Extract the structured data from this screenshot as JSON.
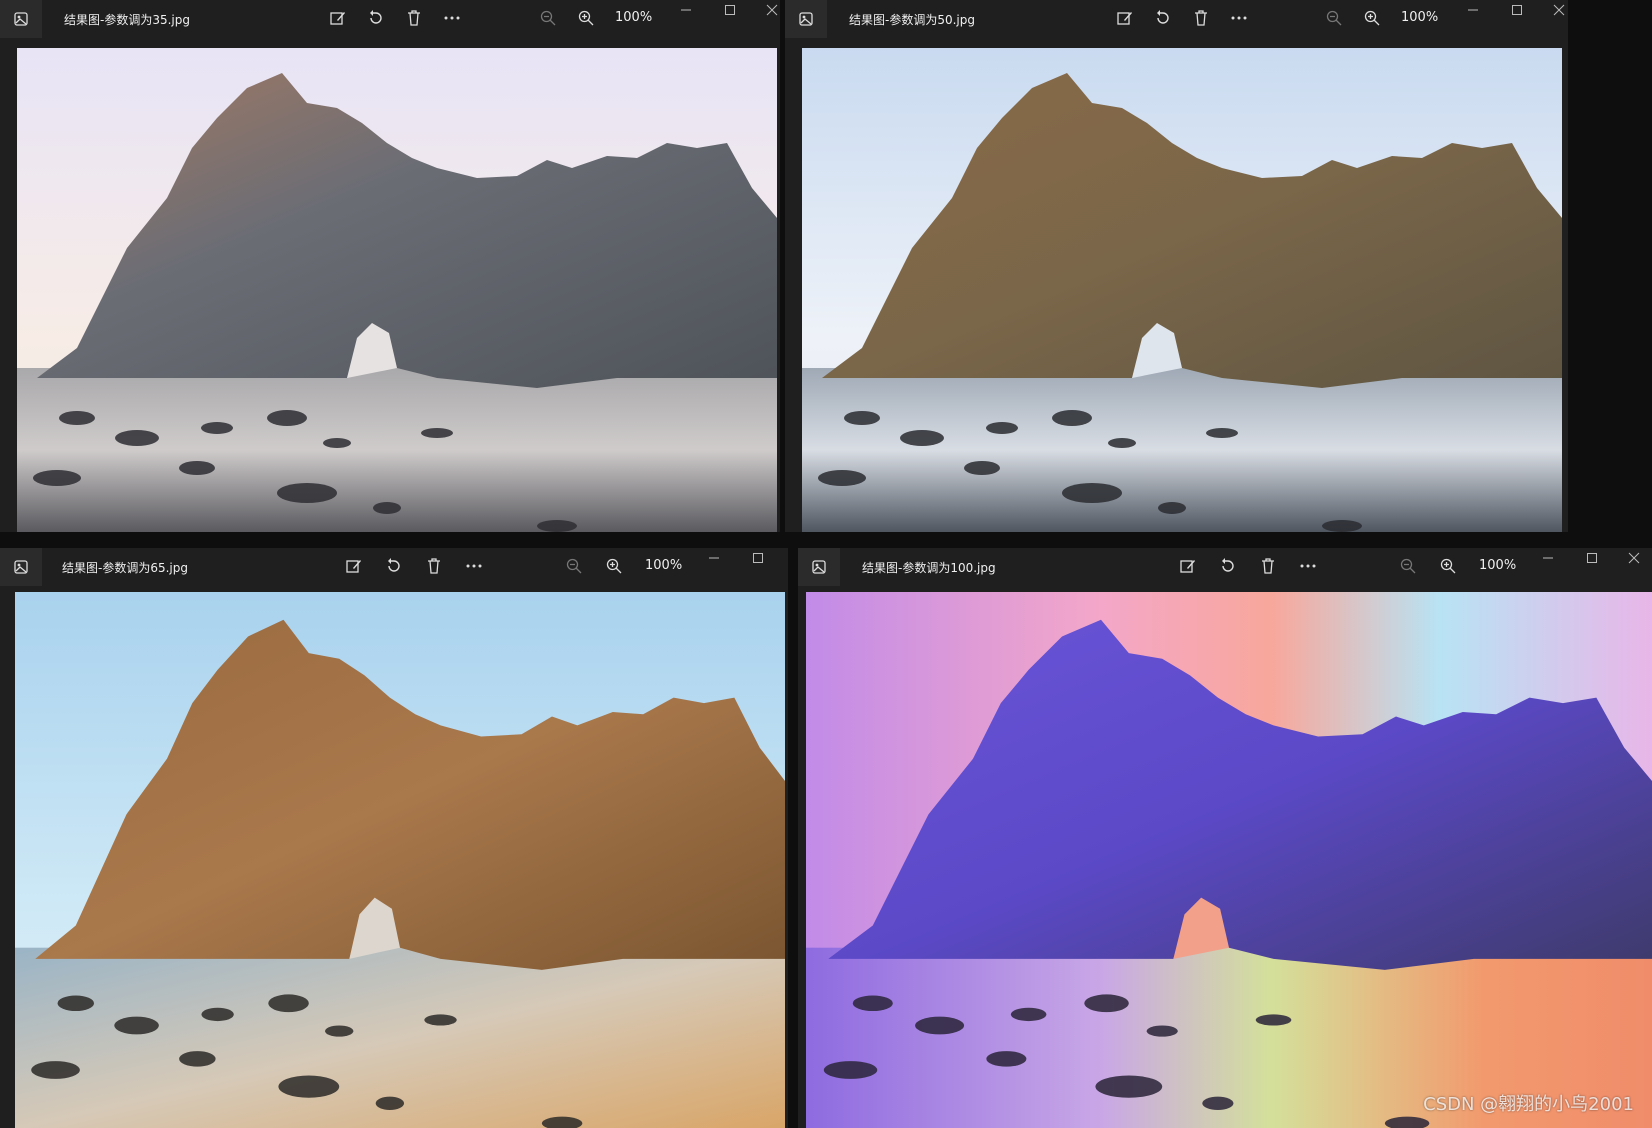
{
  "windows": [
    {
      "id": "w35",
      "title": "结果图-参数调为35.jpg",
      "zoom": "100%",
      "tone": "muted"
    },
    {
      "id": "w50",
      "title": "结果图-参数调为50.jpg",
      "zoom": "100%",
      "tone": "natural"
    },
    {
      "id": "w65",
      "title": "结果图-参数调为65.jpg",
      "zoom": "100%",
      "tone": "warm"
    },
    {
      "id": "w100",
      "title": "结果图-参数调为100.jpg",
      "zoom": "100%",
      "tone": "psychedelic"
    }
  ],
  "watermark": "CSDN @翱翔的小鸟2001",
  "icons": [
    "image-app-icon",
    "edit-icon",
    "rotate-icon",
    "delete-icon",
    "more-icon",
    "zoom-out-icon",
    "zoom-in-icon",
    "minimize-icon",
    "maximize-icon",
    "close-icon"
  ]
}
